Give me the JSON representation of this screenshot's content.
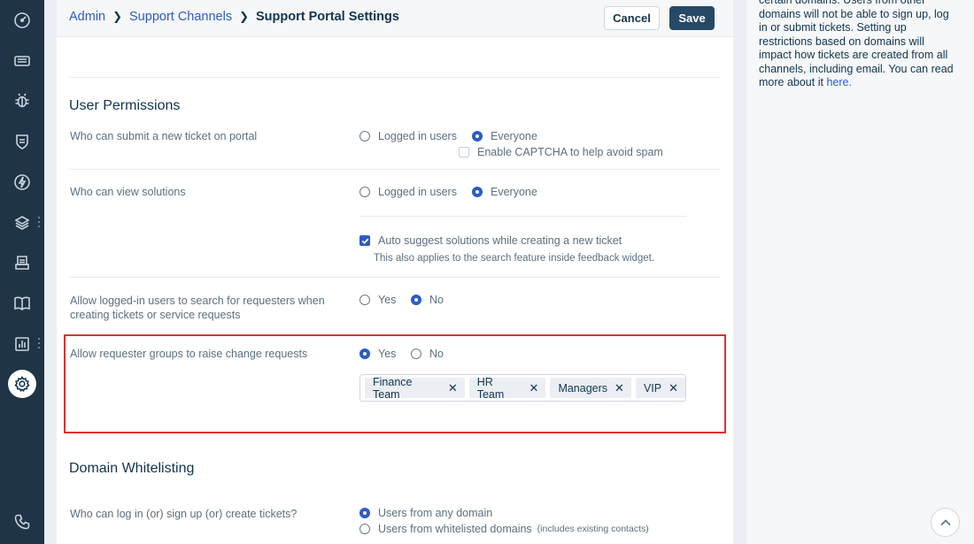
{
  "breadcrumb": {
    "admin": "Admin",
    "channels": "Support Channels",
    "current": "Support Portal Settings"
  },
  "actions": {
    "cancel": "Cancel",
    "save": "Save"
  },
  "user_permissions": {
    "title": "User Permissions",
    "submit_ticket": {
      "label": "Who can submit a new ticket on portal",
      "options": [
        "Logged in users",
        "Everyone"
      ],
      "selected": "Everyone",
      "captcha_label": "Enable CAPTCHA to help avoid spam",
      "captcha_checked": false
    },
    "view_solutions": {
      "label": "Who can view solutions",
      "options": [
        "Logged in users",
        "Everyone"
      ],
      "selected": "Everyone",
      "auto_suggest_label": "Auto suggest solutions while creating a new ticket",
      "auto_suggest_checked": true,
      "auto_suggest_note": "This also applies to the search feature inside feedback widget."
    },
    "search_requesters": {
      "label": "Allow logged-in users to search for requesters when creating tickets or service requests",
      "options": [
        "Yes",
        "No"
      ],
      "selected": "No"
    },
    "change_requests": {
      "label": "Allow requester groups to raise change requests",
      "options": [
        "Yes",
        "No"
      ],
      "selected": "Yes",
      "groups": [
        "Finance Team",
        "HR Team",
        "Managers",
        "VIP"
      ]
    }
  },
  "domain_whitelisting": {
    "title": "Domain Whitelisting",
    "login": {
      "label": "Who can log in (or) sign up (or) create tickets?",
      "options": [
        "Users from any domain",
        "Users from whitelisted domains"
      ],
      "selected": "Users from any domain",
      "whitelist_note": "(includes existing contacts)"
    }
  },
  "side_help": {
    "text": "certain domains. Users from other domains will not be able to sign up, log in or submit tickets. Setting up restrictions based on domains will impact how tickets are created from all channels, including email. You can read more about it",
    "link": "here."
  },
  "nav_icons": [
    "dashboard-icon",
    "tickets-icon",
    "problems-icon",
    "changes-icon",
    "releases-icon",
    "assets-icon",
    "inbox-icon",
    "solutions-icon",
    "analytics-icon",
    "admin-gear-icon",
    "phone-icon"
  ],
  "colors": {
    "accent": "#2c5cc5",
    "nav_bg": "#1f3446",
    "highlight": "#e0312b",
    "save_bg": "#264966"
  }
}
